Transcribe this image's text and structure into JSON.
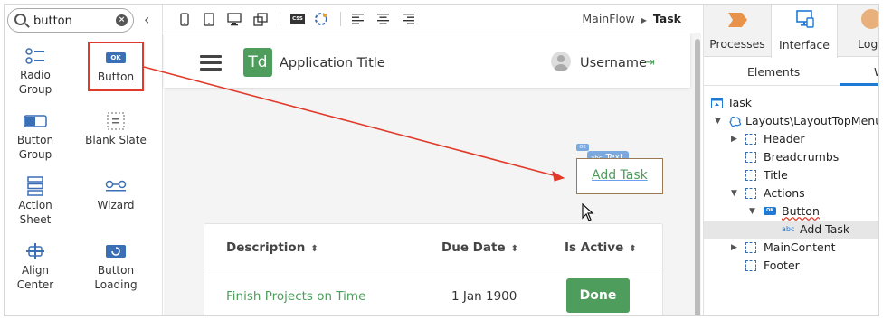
{
  "toolbox": {
    "search": {
      "value": "button"
    },
    "items": [
      {
        "label": "Radio Group",
        "icon": "radio-group-icon"
      },
      {
        "label": "Button",
        "icon": "button-icon",
        "badge": "OK"
      },
      {
        "label": "Button Group",
        "icon": "button-group-icon"
      },
      {
        "label": "Blank Slate",
        "icon": "blank-slate-icon"
      },
      {
        "label": "Action Sheet",
        "icon": "action-sheet-icon"
      },
      {
        "label": "Wizard",
        "icon": "wizard-icon"
      },
      {
        "label": "Align Center",
        "icon": "align-center-icon"
      },
      {
        "label": "Button Loading",
        "icon": "button-loading-icon"
      }
    ]
  },
  "canvas_toolbar": {
    "css_label": "CSS",
    "breadcrumb": {
      "parent": "MainFlow",
      "current": "Task"
    }
  },
  "app": {
    "logo": "Td",
    "title": "Application Title",
    "username": "Username"
  },
  "widget": {
    "badge": "OK",
    "tag_prefix": "abc",
    "tag": "Text",
    "text": "Add Task"
  },
  "table": {
    "headers": [
      "Description",
      "Due Date",
      "Is Active"
    ],
    "row": {
      "description": "Finish Projects on Time",
      "due_date": "1 Jan 1900",
      "action": "Done"
    }
  },
  "right_panel": {
    "tabs": [
      "Processes",
      "Interface",
      "Log"
    ],
    "subtabs": [
      "Elements",
      "W"
    ],
    "tree": [
      {
        "label": "Task",
        "icon": "screen-icon"
      },
      {
        "label": "Layouts\\LayoutTopMenu",
        "icon": "block-icon"
      },
      {
        "label": "Header",
        "icon": "placeholder-icon"
      },
      {
        "label": "Breadcrumbs",
        "icon": "placeholder-icon"
      },
      {
        "label": "Title",
        "icon": "placeholder-icon"
      },
      {
        "label": "Actions",
        "icon": "placeholder-icon"
      },
      {
        "label": "Button",
        "icon": "button-icon",
        "badge": "OK"
      },
      {
        "label": "Add Task",
        "icon": "text-icon",
        "prefix": "abc"
      },
      {
        "label": "MainContent",
        "icon": "placeholder-icon"
      },
      {
        "label": "Footer",
        "icon": "placeholder-icon"
      }
    ]
  },
  "colors": {
    "accent_green": "#4e9d5c",
    "selection_red": "#e03b2a",
    "widget_blue": "#7aa9e0",
    "tab_underline": "#1f7ad6"
  }
}
